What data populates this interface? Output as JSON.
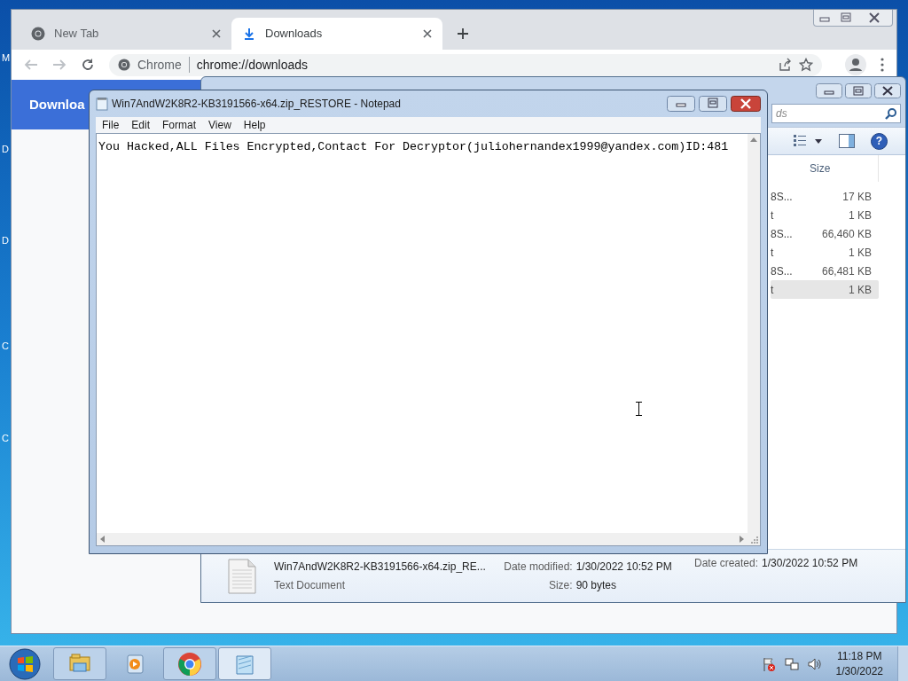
{
  "desktop": {
    "icon_labels": [
      "M",
      "D",
      "D",
      "C",
      "C"
    ]
  },
  "chrome": {
    "tabs": [
      {
        "title": "New Tab",
        "selected": false
      },
      {
        "title": "Downloads",
        "selected": true
      }
    ],
    "address": {
      "site_label": "Chrome",
      "url": "chrome://downloads"
    },
    "page": {
      "heading": "Downloa"
    }
  },
  "explorer": {
    "search": {
      "placeholder": "ds"
    },
    "help_button": "?",
    "columns": [
      "Size"
    ],
    "rows": [
      {
        "name": "8S...",
        "size": "17 KB",
        "selected": false
      },
      {
        "name": "t",
        "size": "1 KB",
        "selected": false
      },
      {
        "name": "8S...",
        "size": "66,460 KB",
        "selected": false
      },
      {
        "name": "t",
        "size": "1 KB",
        "selected": false
      },
      {
        "name": "8S...",
        "size": "66,481 KB",
        "selected": false
      },
      {
        "name": "t",
        "size": "1 KB",
        "selected": true
      }
    ],
    "details": {
      "file_name": "Win7AndW2K8R2-KB3191566-x64.zip_RE...",
      "file_type": "Text Document",
      "modified_label": "Date modified:",
      "modified": "1/30/2022 10:52 PM",
      "size_label": "Size:",
      "size": "90 bytes",
      "created_label": "Date created:",
      "created": "1/30/2022 10:52 PM"
    }
  },
  "notepad": {
    "title": "Win7AndW2K8R2-KB3191566-x64.zip_RESTORE - Notepad",
    "menu": [
      "File",
      "Edit",
      "Format",
      "View",
      "Help"
    ],
    "text": "You Hacked,ALL Files Encrypted,Contact For Decryptor(juliohernandex1999@yandex.com)ID:481"
  },
  "taskbar": {
    "apps": [
      {
        "kind": "explorer",
        "running": true,
        "selected": false
      },
      {
        "kind": "media",
        "running": false,
        "selected": false
      },
      {
        "kind": "chrome",
        "running": true,
        "selected": false
      },
      {
        "kind": "notepad",
        "running": true,
        "selected": true
      }
    ],
    "clock": {
      "time": "11:18 PM",
      "date": "1/30/2022"
    }
  }
}
